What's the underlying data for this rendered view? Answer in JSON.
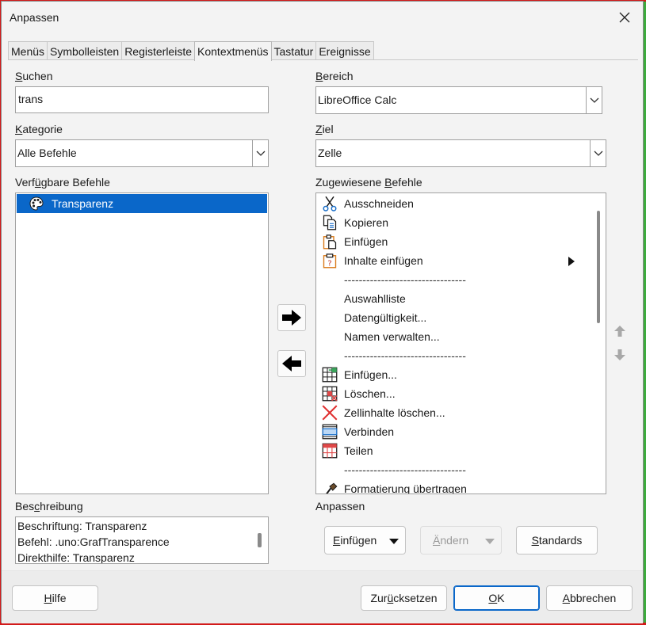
{
  "window": {
    "title": "Anpassen"
  },
  "tabs": [
    {
      "label": "Menüs"
    },
    {
      "label": "Symbolleisten"
    },
    {
      "label": "Registerleiste"
    },
    {
      "label": "Kontextmenüs",
      "active": true
    },
    {
      "label": "Tastatur"
    },
    {
      "label": "Ereignisse"
    }
  ],
  "left": {
    "search_label_u": "S",
    "search_label_rest": "uchen",
    "search_value": "trans",
    "category_label_u": "K",
    "category_label_rest": "ategorie",
    "category_value": "Alle Befehle",
    "available_label_pre": "Verf",
    "available_label_u": "ü",
    "available_label_rest": "gbare Befehle",
    "available_items": [
      {
        "label": "Transparenz",
        "icon": "palette-icon",
        "selected": true
      }
    ],
    "description_label_pre": "Bes",
    "description_label_u": "c",
    "description_label_rest": "hreibung",
    "description_lines": [
      "Beschriftung: Transparenz",
      "Befehl: .uno:GrafTransparence",
      "Direkthilfe: Transparenz"
    ]
  },
  "right": {
    "scope_label_u": "B",
    "scope_label_rest": "ereich",
    "scope_value": "LibreOffice Calc",
    "target_label_u": "Z",
    "target_label_rest": "iel",
    "target_value": "Zelle",
    "assigned_label_pre": "Zugewiesene ",
    "assigned_label_u": "B",
    "assigned_label_rest": "efehle",
    "assigned_items": [
      {
        "label": "Ausschneiden",
        "icon": "scissors-icon"
      },
      {
        "label": "Kopieren",
        "icon": "copy-icon"
      },
      {
        "label": "Einfügen",
        "icon": "paste-icon"
      },
      {
        "label": "Inhalte einfügen",
        "icon": "paste-special-icon",
        "submenu": true
      },
      {
        "label": "---------------------------------",
        "separator": true
      },
      {
        "label": "Auswahlliste"
      },
      {
        "label": "Datengültigkeit..."
      },
      {
        "label": "Namen verwalten..."
      },
      {
        "label": "---------------------------------",
        "separator": true
      },
      {
        "label": "Einfügen...",
        "icon": "insert-cells-icon"
      },
      {
        "label": "Löschen...",
        "icon": "delete-cells-icon"
      },
      {
        "label": "Zellinhalte löschen...",
        "icon": "clear-contents-icon"
      },
      {
        "label": "Verbinden",
        "icon": "merge-cells-icon"
      },
      {
        "label": "Teilen",
        "icon": "split-cells-icon"
      },
      {
        "label": "---------------------------------",
        "separator": true
      },
      {
        "label": "Formatierung übertragen",
        "icon": "clone-formatting-icon"
      }
    ],
    "customize_label": "Anpassen",
    "insert_button_u": "E",
    "insert_button_rest": "infügen",
    "modify_button_u": "Ä",
    "modify_button_rest": "ndern",
    "defaults_button_u": "S",
    "defaults_button_rest": "tandards"
  },
  "footer": {
    "help_u": "H",
    "help_rest": "ilfe",
    "reset_pre": "Zur",
    "reset_u": "ü",
    "reset_rest": "cksetzen",
    "ok_u": "O",
    "ok_rest": "K",
    "cancel_u": "A",
    "cancel_rest": "bbrechen"
  },
  "colors": {
    "selection": "#0a67c9",
    "dialog_bg": "#f3f3f3"
  }
}
